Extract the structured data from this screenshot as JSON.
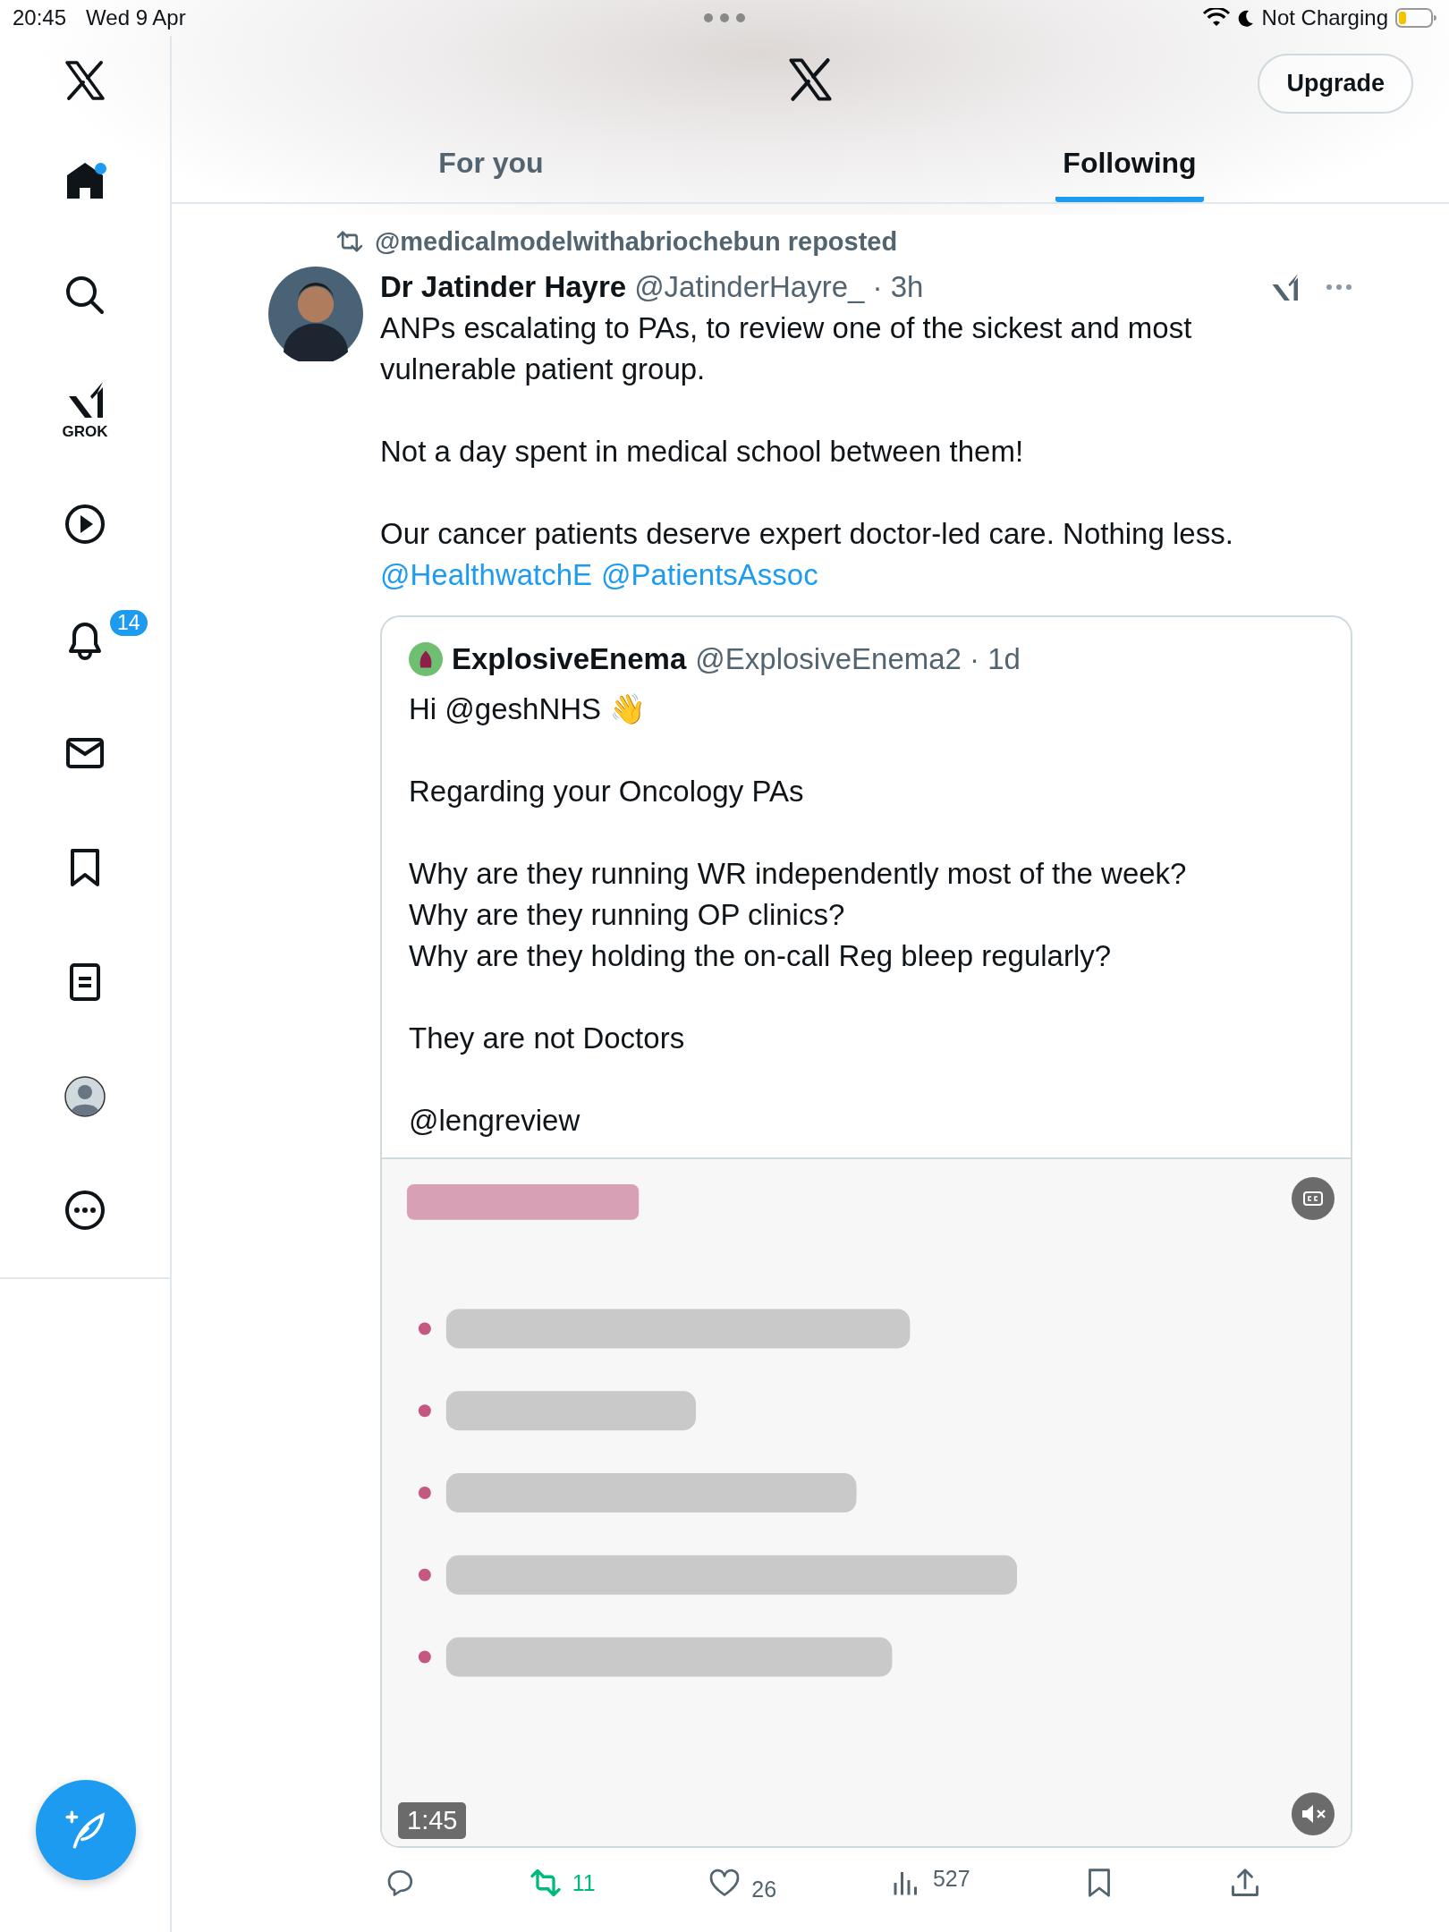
{
  "status_bar": {
    "time": "20:45",
    "date": "Wed 9 Apr",
    "battery_text": "Not Charging"
  },
  "sidebar": {
    "items": [
      {
        "kind": "logo",
        "selected": false
      },
      {
        "kind": "home",
        "selected": true,
        "new_dot": true
      },
      {
        "kind": "search",
        "selected": false
      },
      {
        "kind": "grok",
        "selected": false,
        "label": "GROK"
      },
      {
        "kind": "video",
        "selected": false
      },
      {
        "kind": "notifications",
        "selected": false,
        "badge": "14"
      },
      {
        "kind": "messages",
        "selected": false
      },
      {
        "kind": "bookmarks",
        "selected": false
      },
      {
        "kind": "lists",
        "selected": false
      },
      {
        "kind": "profile",
        "selected": false
      },
      {
        "kind": "more",
        "selected": false
      }
    ]
  },
  "header": {
    "upgrade_button": "Upgrade",
    "tabs": [
      {
        "label": "For you",
        "selected": false
      },
      {
        "label": "Following",
        "selected": true
      }
    ]
  },
  "post": {
    "repost_line": "@medicalmodelwithabriochebun reposted",
    "author": "Dr Jatinder Hayre",
    "meta": "@JatinderHayre_ · 3h",
    "paragraphs": [
      "ANPs escalating to PAs, to review one of the sickest and most vulnerable patient group.",
      "Not a day spent in medical school between them!",
      "Our cancer patients deserve expert doctor-led care. Nothing less."
    ],
    "mentions": [
      "@HealthwatchE",
      "@PatientsAssoc"
    ],
    "quote": {
      "author": "ExplosiveEnema",
      "meta": "@ExplosiveEnema2 · 1d",
      "paragraphs": [
        "Hi @geshNHS 👋",
        "Regarding your Oncology PAs",
        "Why are they running WR independently most of the week?\nWhy are they running OP clinics?\nWhy are they holding the on-call Reg bleep regularly?",
        "They are not Doctors",
        "@lengreview"
      ],
      "video": {
        "kind": "picture",
        "duration": "1:45",
        "muted": true,
        "captions": true
      }
    },
    "actions": [
      {
        "kind": "reply",
        "active": false
      },
      {
        "kind": "repost",
        "count": "11",
        "active": true
      },
      {
        "kind": "like",
        "count": "26",
        "active": false
      },
      {
        "kind": "views",
        "count": "527",
        "active": false
      },
      {
        "kind": "bookmark",
        "active": false
      },
      {
        "kind": "share",
        "active": false
      }
    ]
  }
}
